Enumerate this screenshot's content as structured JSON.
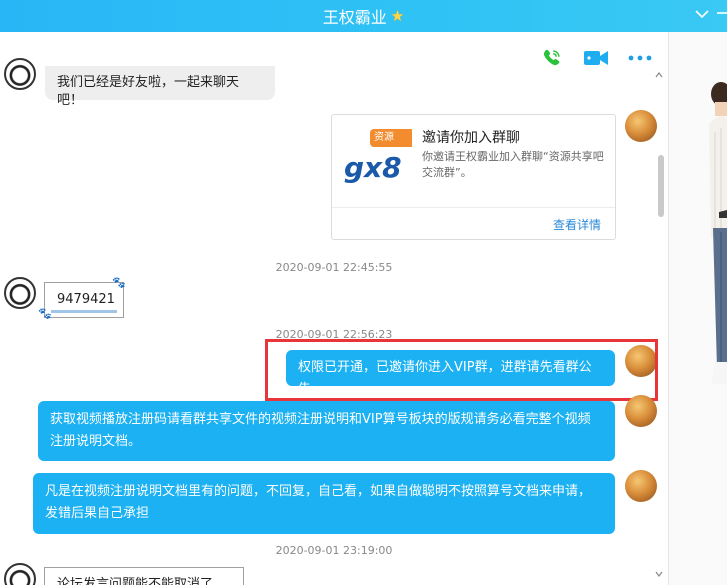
{
  "header": {
    "title": "王权霸业",
    "star_icon": "star-icon",
    "collapse_icon": "chevron-down-icon",
    "minimize_icon": "minimize-icon"
  },
  "toolbar": {
    "voice_icon": "phone-icon",
    "video_icon": "video-icon",
    "more_icon": "more-icon"
  },
  "colors": {
    "titlebar": "#29b6f6",
    "bubble_blue": "#1bb1f2",
    "bubble_gray": "#eeeeee",
    "highlight": "#e8353a",
    "link": "#2a8ad8"
  },
  "messages": {
    "friend_notice": "我们已经是好友啦，一起来聊天吧！",
    "invite_card": {
      "title": "邀请你加入群聊",
      "description": "你邀请王权霸业加入群聊“资源共享吧交流群”。",
      "action": "查看详情",
      "thumb_tag": "资源",
      "thumb_logo": "gx8"
    },
    "timestamp_1": "2020-09-01 22:45:55",
    "sticker_text": "9479421",
    "timestamp_2": "2020-09-01 22:56:23",
    "msg_vip": "权限已开通，已邀请你进入VIP群，进群请先看群公告",
    "msg_register": "获取视频播放注册码请看群共享文件的视频注册说明和VIP算号板块的版规请务必看完整个视频注册说明文档。",
    "msg_rules": "凡是在视频注册说明文档里有的问题，不回复，自己看，如果自做聪明不按照算号文档来申请，发错后果自己承担",
    "timestamp_3": "2020-09-01 23:19:00",
    "partial_last": "论坛发言问题能不能取消了"
  }
}
